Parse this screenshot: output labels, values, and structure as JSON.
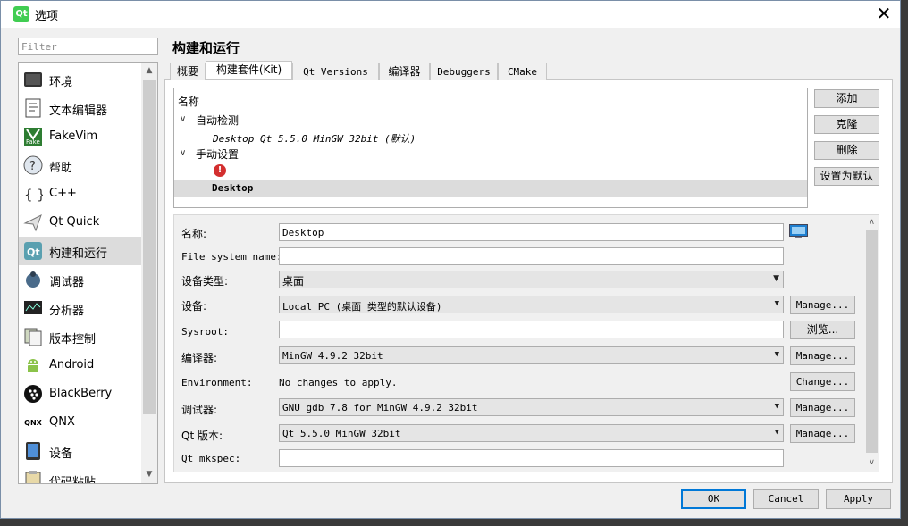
{
  "window": {
    "app_icon_text": "Qt",
    "title": "选项",
    "close_glyph": "✕"
  },
  "sidebar": {
    "filter_placeholder": "Filter",
    "items": [
      {
        "label": "环境",
        "icon": "environment-icon"
      },
      {
        "label": "文本编辑器",
        "icon": "text-editor-icon"
      },
      {
        "label": "FakeVim",
        "icon": "fakevim-icon"
      },
      {
        "label": "帮助",
        "icon": "help-icon"
      },
      {
        "label": "C++",
        "icon": "cpp-icon"
      },
      {
        "label": "Qt Quick",
        "icon": "qt-quick-icon"
      },
      {
        "label": "构建和运行",
        "icon": "build-run-icon",
        "selected": true
      },
      {
        "label": "调试器",
        "icon": "debugger-icon"
      },
      {
        "label": "分析器",
        "icon": "analyzer-icon"
      },
      {
        "label": "版本控制",
        "icon": "version-control-icon"
      },
      {
        "label": "Android",
        "icon": "android-icon"
      },
      {
        "label": "BlackBerry",
        "icon": "blackberry-icon"
      },
      {
        "label": "QNX",
        "icon": "qnx-icon"
      },
      {
        "label": "设备",
        "icon": "devices-icon"
      },
      {
        "label": "代码粘贴",
        "icon": "code-paste-icon"
      }
    ],
    "qnx_icon_text": "QNX"
  },
  "main": {
    "page_title": "构建和运行",
    "tabs": [
      {
        "label": "概要"
      },
      {
        "label": "构建套件(Kit)",
        "active": true
      },
      {
        "label": "Qt Versions"
      },
      {
        "label": "编译器"
      },
      {
        "label": "Debuggers"
      },
      {
        "label": "CMake"
      }
    ],
    "kit_tree": {
      "header": "名称",
      "auto_group": "自动检测",
      "auto_kit": "Desktop Qt 5.5.0 MinGW 32bit (默认)",
      "manual_group": "手动设置",
      "error_glyph": "!",
      "manual_kit": "Desktop"
    },
    "kit_buttons": {
      "add": "添加",
      "clone": "克隆",
      "remove": "删除",
      "make_default": "设置为默认"
    },
    "details": {
      "name_label": "名称:",
      "name_value": "Desktop",
      "fs_name_label": "File system name:",
      "fs_name_value": "",
      "device_type_label": "设备类型:",
      "device_type_value": "桌面",
      "device_label": "设备:",
      "device_value": "Local PC (桌面 类型的默认设备)",
      "device_manage": "Manage...",
      "sysroot_label": "Sysroot:",
      "sysroot_value": "",
      "sysroot_browse": "浏览...",
      "compiler_label": "编译器:",
      "compiler_value": "MinGW 4.9.2 32bit",
      "compiler_manage": "Manage...",
      "environment_label": "Environment:",
      "environment_value": "No changes to apply.",
      "environment_change": "Change...",
      "debugger_label": "调试器:",
      "debugger_value": "GNU gdb 7.8 for MinGW 4.9.2 32bit",
      "debugger_manage": "Manage...",
      "qt_version_label": "Qt 版本:",
      "qt_version_value": "Qt 5.5.0 MinGW 32bit",
      "qt_version_manage": "Manage...",
      "mkspec_label": "Qt mkspec:",
      "mkspec_value": ""
    }
  },
  "footer": {
    "ok": "OK",
    "cancel": "Cancel",
    "apply": "Apply"
  },
  "colors": {
    "accent": "#0078d7",
    "selected_row": "#dcdcdc",
    "error": "#d32f2f"
  }
}
